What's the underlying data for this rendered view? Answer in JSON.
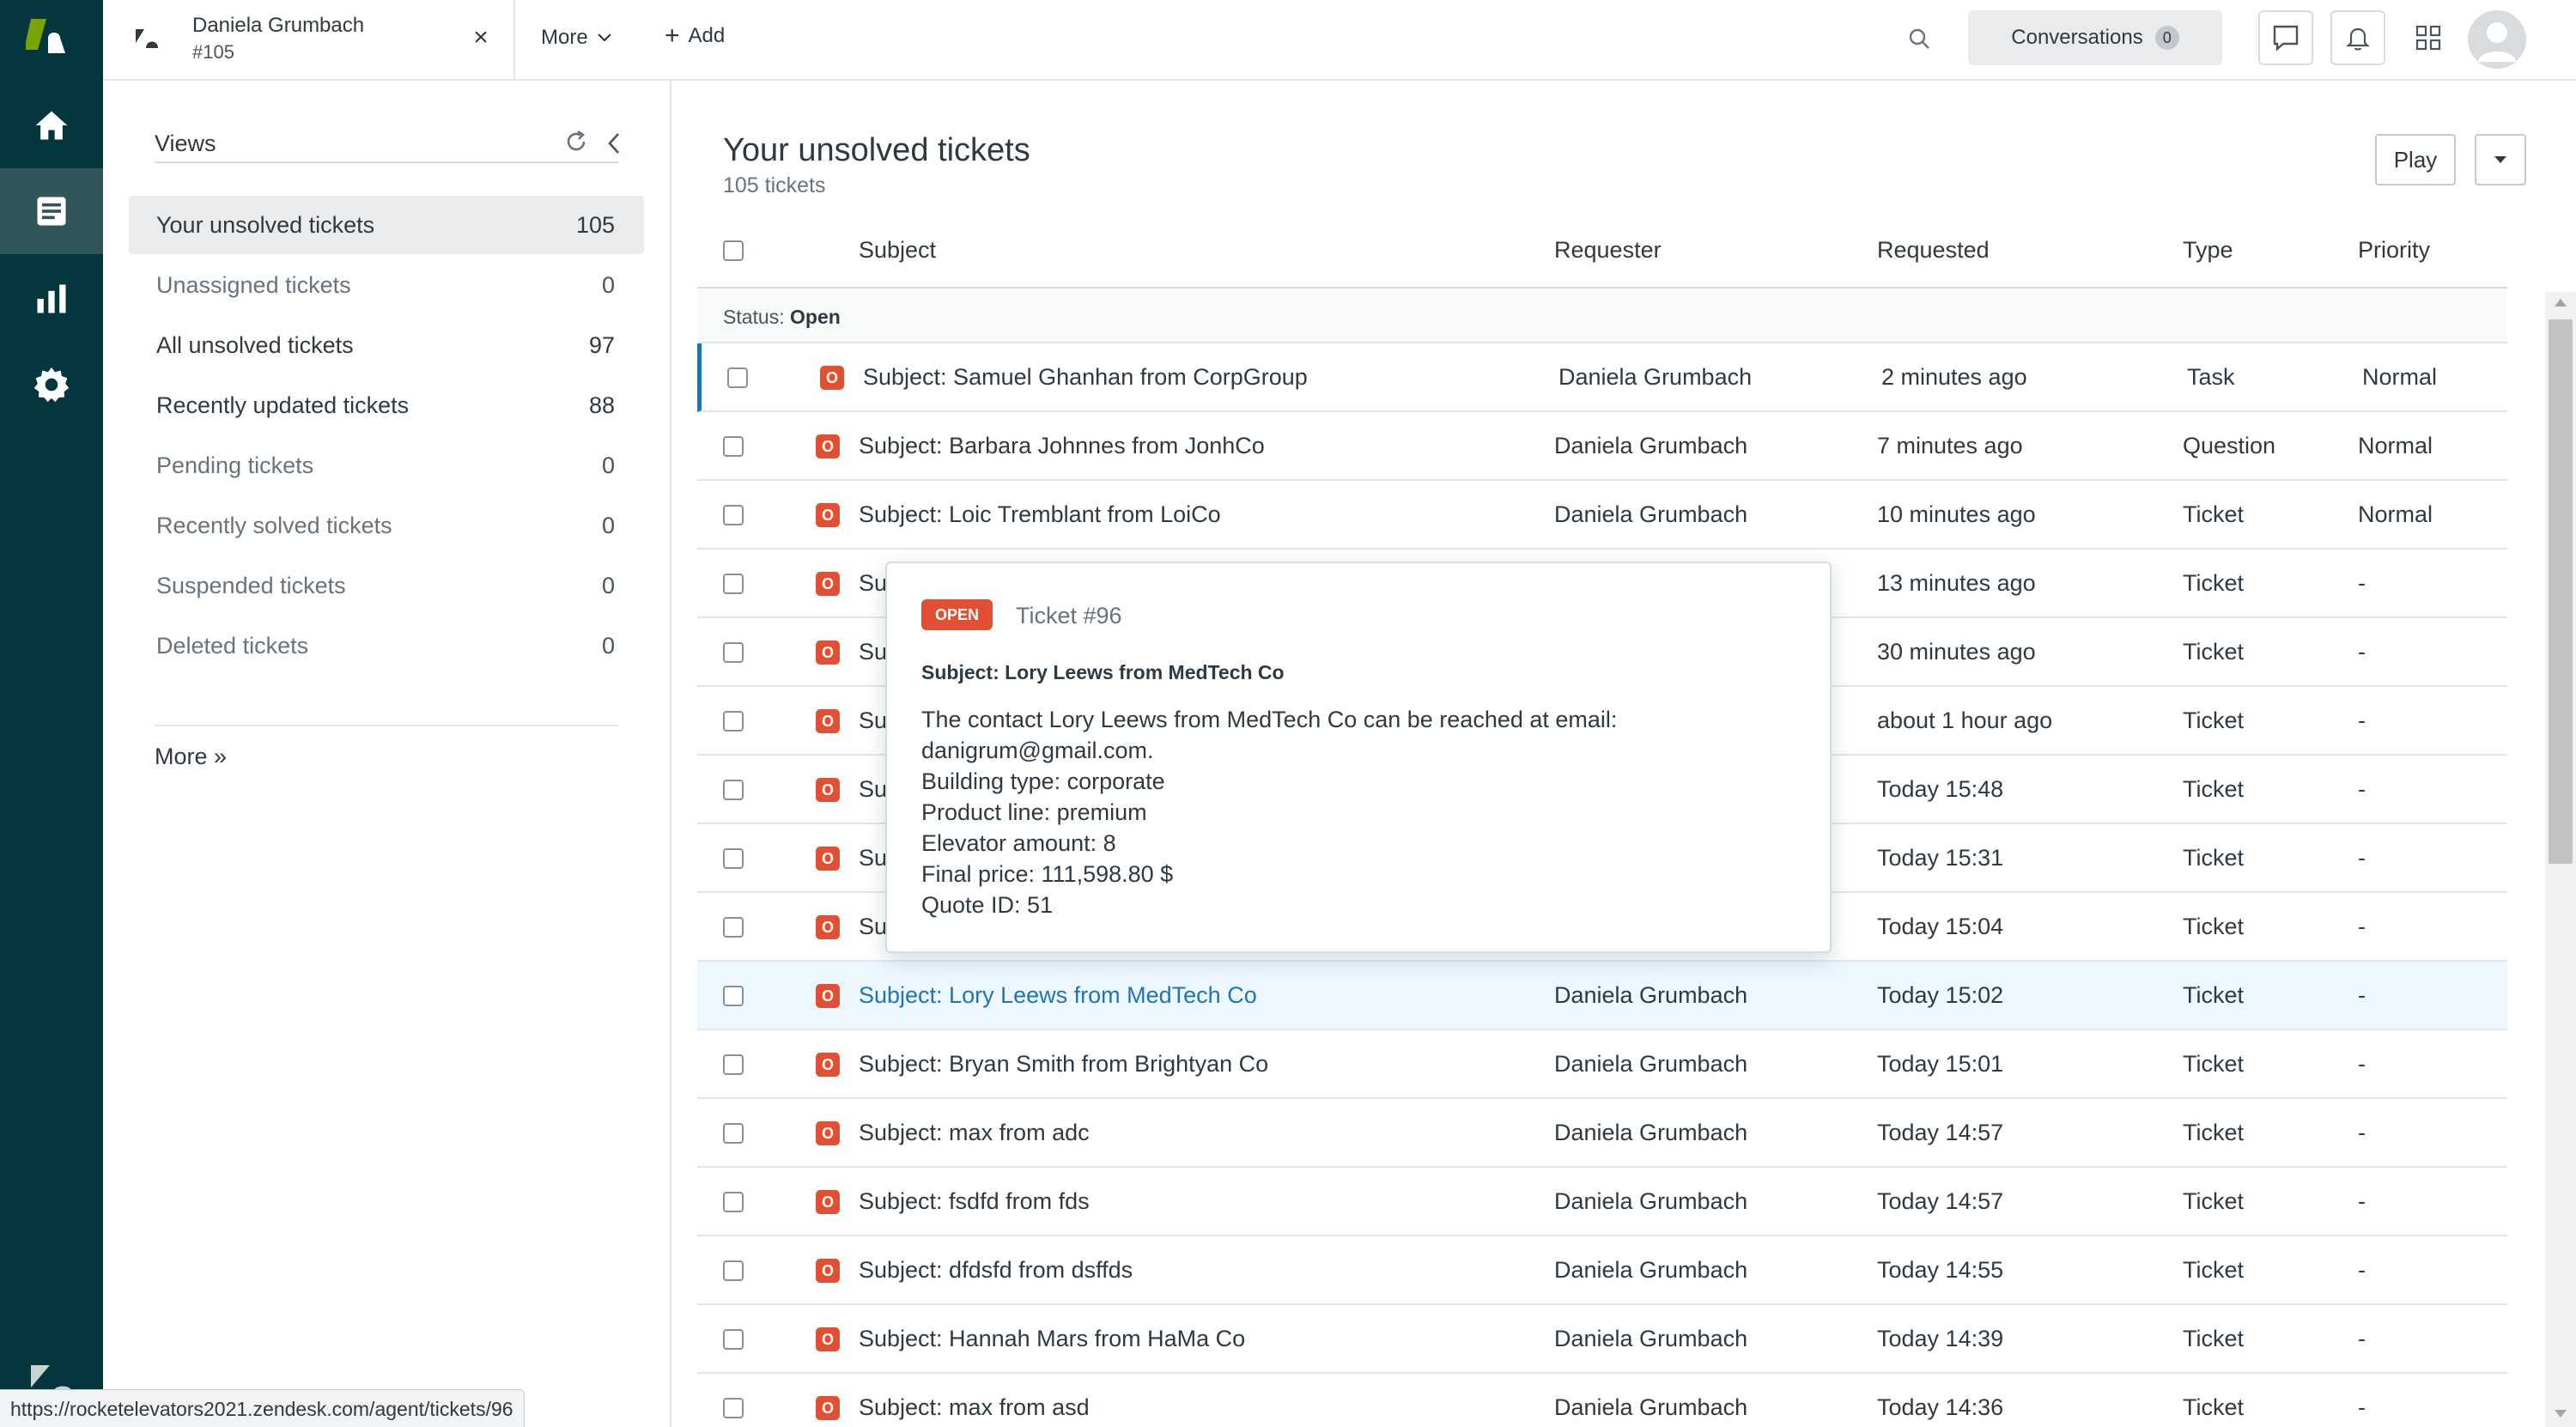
{
  "topbar": {
    "ticket_tab": {
      "name": "Daniela Grumbach",
      "number": "#105"
    },
    "more_label": "More",
    "add_label": "Add",
    "conversations": {
      "label": "Conversations",
      "count": "0"
    }
  },
  "views": {
    "title": "Views",
    "items": [
      {
        "label": "Your unsolved tickets",
        "count": "105"
      },
      {
        "label": "Unassigned tickets",
        "count": "0"
      },
      {
        "label": "All unsolved tickets",
        "count": "97"
      },
      {
        "label": "Recently updated tickets",
        "count": "88"
      },
      {
        "label": "Pending tickets",
        "count": "0"
      },
      {
        "label": "Recently solved tickets",
        "count": "0"
      },
      {
        "label": "Suspended tickets",
        "count": "0"
      },
      {
        "label": "Deleted tickets",
        "count": "0"
      }
    ],
    "more_link": "More »"
  },
  "main": {
    "title": "Your unsolved tickets",
    "subtitle": "105 tickets",
    "play_label": "Play",
    "columns": {
      "subject": "Subject",
      "requester": "Requester",
      "requested": "Requested",
      "type": "Type",
      "priority": "Priority"
    },
    "status_group": {
      "prefix": "Status:",
      "value": "Open"
    },
    "status_letter": "O",
    "rows": [
      {
        "subject": "Subject: Samuel Ghanhan from CorpGroup",
        "requester": "Daniela Grumbach",
        "requested": "2 minutes ago",
        "type": "Task",
        "priority": "Normal"
      },
      {
        "subject": "Subject: Barbara Johnnes from JonhCo",
        "requester": "Daniela Grumbach",
        "requested": "7 minutes ago",
        "type": "Question",
        "priority": "Normal"
      },
      {
        "subject": "Subject: Loic Tremblant from LoiCo",
        "requester": "Daniela Grumbach",
        "requested": "10 minutes ago",
        "type": "Ticket",
        "priority": "Normal"
      },
      {
        "subject": "Su",
        "requester": "",
        "requested": "13 minutes ago",
        "type": "Ticket",
        "priority": "-"
      },
      {
        "subject": "Su",
        "requester": "",
        "requested": "30 minutes ago",
        "type": "Ticket",
        "priority": "-"
      },
      {
        "subject": "Su",
        "requester": "",
        "requested": "about 1 hour ago",
        "type": "Ticket",
        "priority": "-"
      },
      {
        "subject": "Su",
        "requester": "",
        "requested": "Today 15:48",
        "type": "Ticket",
        "priority": "-"
      },
      {
        "subject": "Su",
        "requester": "",
        "requested": "Today 15:31",
        "type": "Ticket",
        "priority": "-"
      },
      {
        "subject": "Su",
        "requester": "",
        "requested": "Today 15:04",
        "type": "Ticket",
        "priority": "-"
      },
      {
        "subject": "Subject: Lory Leews from MedTech Co",
        "requester": "Daniela Grumbach",
        "requested": "Today 15:02",
        "type": "Ticket",
        "priority": "-"
      },
      {
        "subject": "Subject: Bryan Smith from Brightyan Co",
        "requester": "Daniela Grumbach",
        "requested": "Today 15:01",
        "type": "Ticket",
        "priority": "-"
      },
      {
        "subject": "Subject: max from adc",
        "requester": "Daniela Grumbach",
        "requested": "Today 14:57",
        "type": "Ticket",
        "priority": "-"
      },
      {
        "subject": "Subject: fsdfd from fds",
        "requester": "Daniela Grumbach",
        "requested": "Today 14:57",
        "type": "Ticket",
        "priority": "-"
      },
      {
        "subject": "Subject: dfdsfd from dsffds",
        "requester": "Daniela Grumbach",
        "requested": "Today 14:55",
        "type": "Ticket",
        "priority": "-"
      },
      {
        "subject": "Subject: Hannah Mars from HaMa Co",
        "requester": "Daniela Grumbach",
        "requested": "Today 14:39",
        "type": "Ticket",
        "priority": "-"
      },
      {
        "subject": "Subject: max from asd",
        "requester": "Daniela Grumbach",
        "requested": "Today 14:36",
        "type": "Ticket",
        "priority": "-"
      }
    ]
  },
  "preview": {
    "status": "OPEN",
    "ticket": "Ticket #96",
    "subject": "Subject: Lory Leews from MedTech Co",
    "lines": [
      "The contact Lory Leews from MedTech Co can be reached at email:",
      "danigrum@gmail.com.",
      "Building type: corporate",
      "Product line: premium",
      "Elevator amount: 8",
      "Final price: 111,598.80 $",
      "Quote ID: 51"
    ]
  },
  "statusbar": {
    "url": "https://rocketelevators2021.zendesk.com/agent/tickets/96"
  },
  "colors": {
    "rail": "#03363d",
    "rail_active": "#30555a",
    "logo_green": "#78a300",
    "open_badge": "#e34f32",
    "link_blue": "#1f73b7",
    "hover_row": "#edf7ff"
  },
  "icons": {
    "rail": [
      "home-icon",
      "tickets-icon",
      "reporting-icon",
      "settings-icon"
    ],
    "top": [
      "search-icon",
      "chat-icon",
      "bell-icon",
      "apps-grid-icon",
      "user-avatar-icon"
    ]
  }
}
